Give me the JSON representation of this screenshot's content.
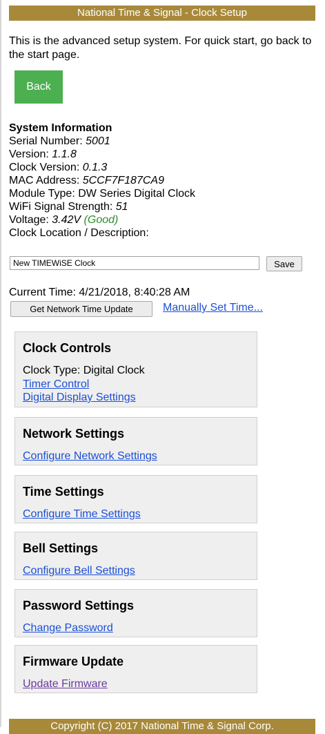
{
  "header": {
    "title": "National Time & Signal - Clock Setup"
  },
  "intro": {
    "text": "This is the advanced setup system. For quick start, go back to the start page."
  },
  "back_button": {
    "label": "Back"
  },
  "system_info": {
    "heading": "System Information",
    "serial_label": "Serial Number: ",
    "serial_value": "5001",
    "version_label": "Version: ",
    "version_value": "1.1.8",
    "clock_version_label": "Clock Version: ",
    "clock_version_value": "0.1.3",
    "mac_label": "MAC Address: ",
    "mac_value": "5CCF7F187CA9",
    "module_type": "Module Type: DW Series Digital Clock",
    "wifi_label": "WiFi Signal Strength: ",
    "wifi_value": "51",
    "voltage_label": "Voltage: ",
    "voltage_value": "3.42V",
    "voltage_status": "(Good)",
    "location_label": "Clock Location / Description:"
  },
  "location_input": {
    "value": "New TIMEWiSE Clock",
    "save_label": "Save"
  },
  "time": {
    "current": "Current Time: 4/21/2018, 8:40:28 AM",
    "network_button": "Get Network Time Update",
    "manual_link": "Manually Set Time..."
  },
  "panels": {
    "clock": {
      "title": "Clock Controls",
      "clock_type": "Clock Type: Digital Clock",
      "timer_link": "Timer Control",
      "display_link": "Digital Display Settings"
    },
    "network": {
      "title": "Network Settings",
      "link": "Configure Network Settings"
    },
    "time": {
      "title": "Time Settings",
      "link": "Configure Time Settings"
    },
    "bell": {
      "title": "Bell Settings",
      "link": "Configure Bell Settings"
    },
    "password": {
      "title": "Password Settings",
      "link": "Change Password"
    },
    "firmware": {
      "title": "Firmware Update",
      "link": "Update Firmware"
    }
  },
  "footer": {
    "text": "Copyright (C) 2017 National Time & Signal Corp."
  },
  "colors": {
    "header_bg": "#a8893a",
    "back_button": "#4caf50",
    "link": "#1a4fd6",
    "visited_link": "#6b3aa0",
    "good_status": "#2e8b2e"
  }
}
